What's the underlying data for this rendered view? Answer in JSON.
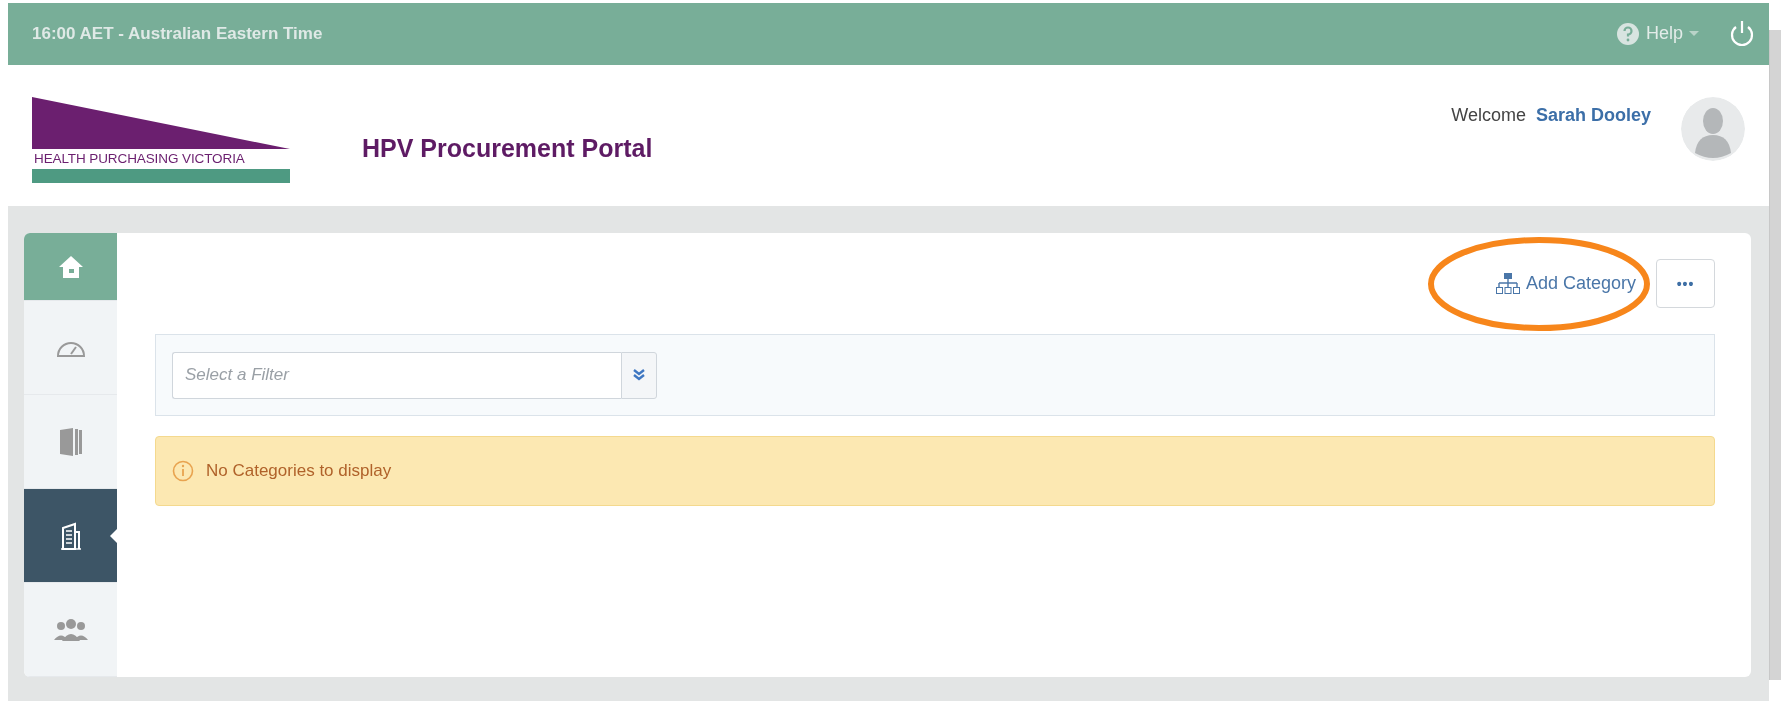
{
  "top_bar": {
    "time_zone": "16:00 AET - Australian Eastern Time",
    "help_label": "Help"
  },
  "header": {
    "logo_text": "HEALTH PURCHASING VICTORIA",
    "title": "HPV Procurement Portal",
    "welcome_label": "Welcome",
    "user_name": "Sarah Dooley"
  },
  "sidebar": {
    "items": [
      {
        "kind": "home",
        "selected": false
      },
      {
        "kind": "dashboard",
        "selected": false
      },
      {
        "kind": "document",
        "selected": false
      },
      {
        "kind": "building",
        "selected": true
      },
      {
        "kind": "people",
        "selected": false
      }
    ]
  },
  "toolbar": {
    "add_category_label": "Add Category",
    "more_label": "•••"
  },
  "filter": {
    "placeholder": "Select a Filter"
  },
  "alert": {
    "message": "No Categories to display"
  }
}
